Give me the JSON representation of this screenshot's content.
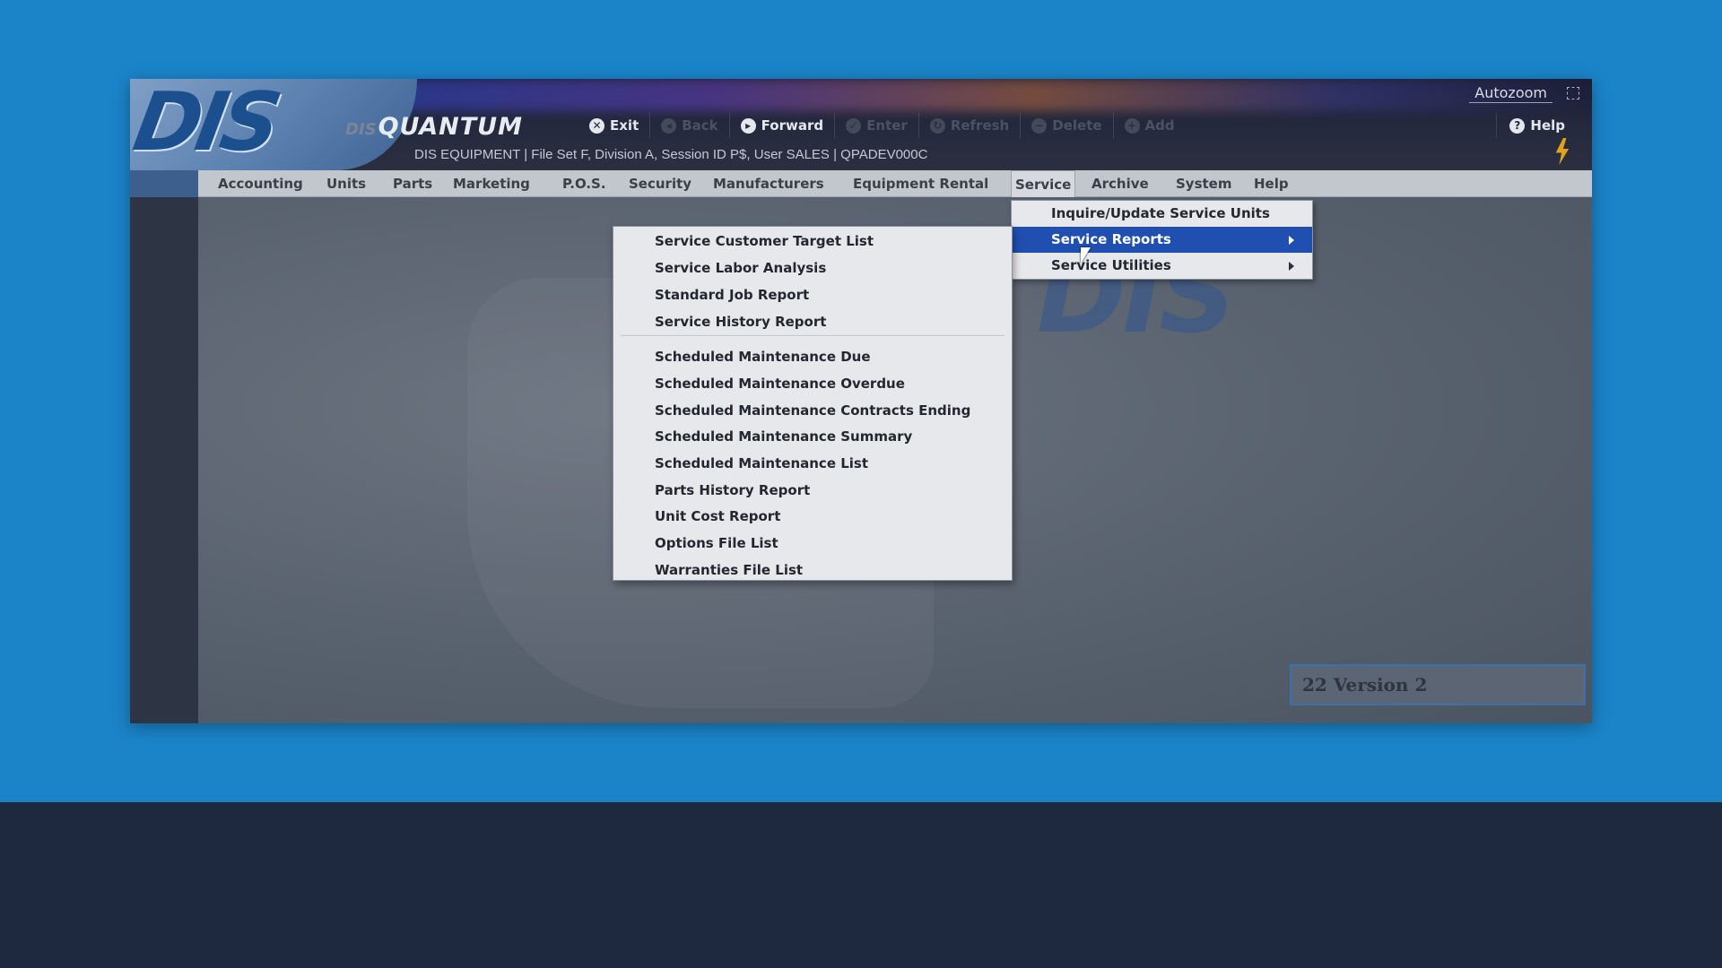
{
  "app": {
    "logo": "DIS",
    "brand_prefix": "DIS",
    "brand_name": "QUANTUM",
    "session_info": "DIS EQUIPMENT | File Set F, Division A, Session ID P$, User SALES | QPADEV000C",
    "autozoom": "Autozoom",
    "version": "22 Version 2",
    "watermark": "DIS"
  },
  "toolbar": {
    "exit": "Exit",
    "back": "Back",
    "forward": "Forward",
    "enter": "Enter",
    "refresh": "Refresh",
    "delete": "Delete",
    "add": "Add",
    "help": "Help"
  },
  "menubar": {
    "accounting": "Accounting",
    "units": "Units",
    "parts": "Parts",
    "marketing": "Marketing",
    "pos": "P.O.S.",
    "security": "Security",
    "manufacturers": "Manufacturers",
    "equipment_rental": "Equipment Rental",
    "service": "Service",
    "archive": "Archive",
    "system": "System",
    "help": "Help"
  },
  "service_menu": {
    "items": [
      "Inquire/Update Service Units",
      "Service Reports",
      "Service Utilities"
    ]
  },
  "reports_menu": {
    "items": [
      "Service Customer Target List",
      "Service Labor Analysis",
      "Standard Job Report",
      "Service History Report",
      "Scheduled Maintenance Due",
      "Scheduled Maintenance Overdue",
      "Scheduled Maintenance Contracts Ending",
      "Scheduled Maintenance Summary",
      "Scheduled Maintenance List",
      "Parts History Report",
      "Unit Cost Report",
      "Options File List",
      "Warranties File List"
    ]
  }
}
